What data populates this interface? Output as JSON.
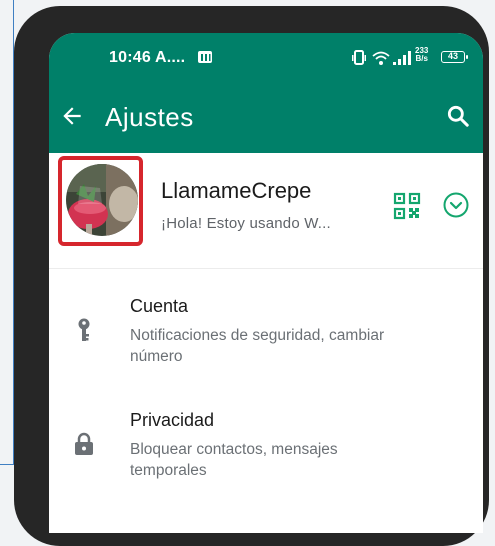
{
  "status_bar": {
    "time": "10:46 A....",
    "speed_value": "233",
    "speed_unit": "B/s",
    "battery": "43"
  },
  "header": {
    "title": "Ajustes",
    "back_icon": "arrow-left-icon",
    "search_icon": "search-icon"
  },
  "profile": {
    "name": "LlamameCrepe",
    "status": "¡Hola! Estoy usando W...",
    "qr_icon": "qr-code-icon",
    "expand_icon": "chevron-circle-down-icon",
    "highlight_color": "#d6262d"
  },
  "settings": [
    {
      "title": "Cuenta",
      "description": "Notificaciones de seguridad, cambiar número",
      "icon": "key-icon"
    },
    {
      "title": "Privacidad",
      "description": "Bloquear contactos, mensajes temporales",
      "icon": "lock-icon"
    }
  ],
  "colors": {
    "primary": "#008069",
    "icon_grey": "#6b7075",
    "qr_green": "#14a66e"
  }
}
